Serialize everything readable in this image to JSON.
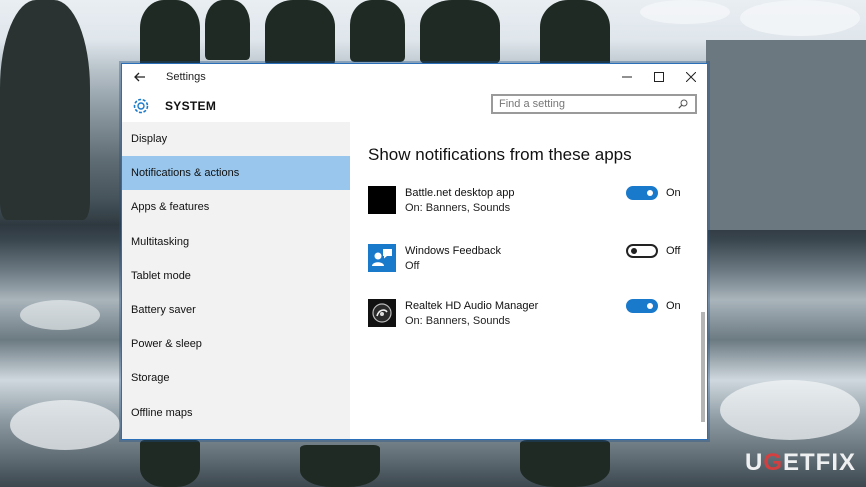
{
  "window": {
    "title": "Settings",
    "section_title": "SYSTEM",
    "search_placeholder": "Find a setting"
  },
  "sidebar": {
    "items": [
      {
        "label": "Display"
      },
      {
        "label": "Notifications & actions",
        "selected": true
      },
      {
        "label": "Apps & features"
      },
      {
        "label": "Multitasking"
      },
      {
        "label": "Tablet mode"
      },
      {
        "label": "Battery saver"
      },
      {
        "label": "Power & sleep"
      },
      {
        "label": "Storage"
      },
      {
        "label": "Offline maps"
      }
    ]
  },
  "content": {
    "heading": "Show notifications from these apps",
    "apps": [
      {
        "name": "Battle.net desktop app",
        "status": "On: Banners, Sounds",
        "toggle_label": "On",
        "on": true,
        "icon": "battlenet-app-icon"
      },
      {
        "name": "Windows Feedback",
        "status": "Off",
        "toggle_label": "Off",
        "on": false,
        "icon": "windows-feedback-icon"
      },
      {
        "name": "Realtek HD Audio Manager",
        "status": "On: Banners, Sounds",
        "toggle_label": "On",
        "on": true,
        "icon": "realtek-audio-icon"
      }
    ]
  },
  "watermark": {
    "text": "UGETFIX"
  },
  "colors": {
    "accent": "#1979ca",
    "selected_nav": "#99c6ec",
    "window_border": "#2b6fb8"
  }
}
